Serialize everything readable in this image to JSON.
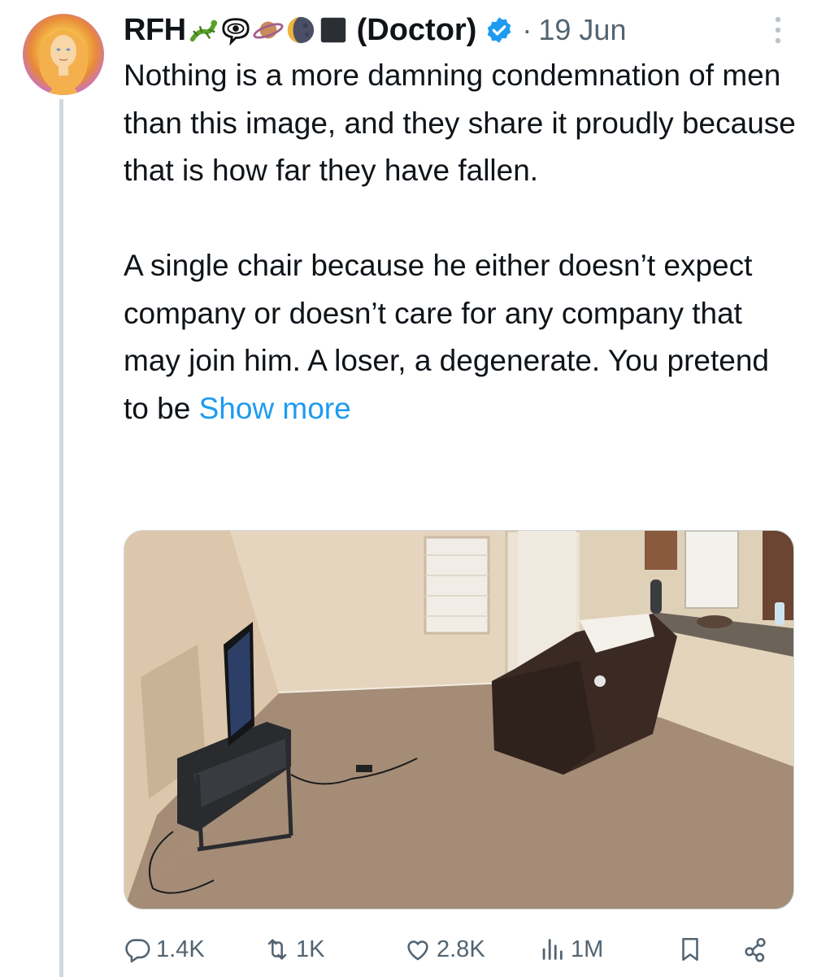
{
  "post": {
    "author_name": "RFH",
    "author_emojis": [
      "lizard-icon",
      "eye-in-speech-bubble-icon",
      "ringed-planet-icon",
      "waning-moon-icon",
      "black-square-icon"
    ],
    "author_title": "(Doctor)",
    "verified_icon": "verified-badge-icon",
    "separator": "·",
    "date": "19 Jun",
    "paragraph_1": "Nothing is a more damning condemnation of men than this image, and they share it proudly because that is how far they have fallen.",
    "paragraph_2": "A single chair because he either doesn’t expect company or doesn’t care for any company that may join him. A loser, a degenerate. You pretend to be",
    "show_more": "Show more",
    "media_icon": "photo-of-living-room-with-recliner-and-tv"
  },
  "actions": {
    "replies": "1.4K",
    "reposts": "1K",
    "likes": "2.8K",
    "views": "1M"
  },
  "colors": {
    "accent": "#1d9bf0",
    "muted": "#536471",
    "thread_line": "#cfd9de"
  }
}
